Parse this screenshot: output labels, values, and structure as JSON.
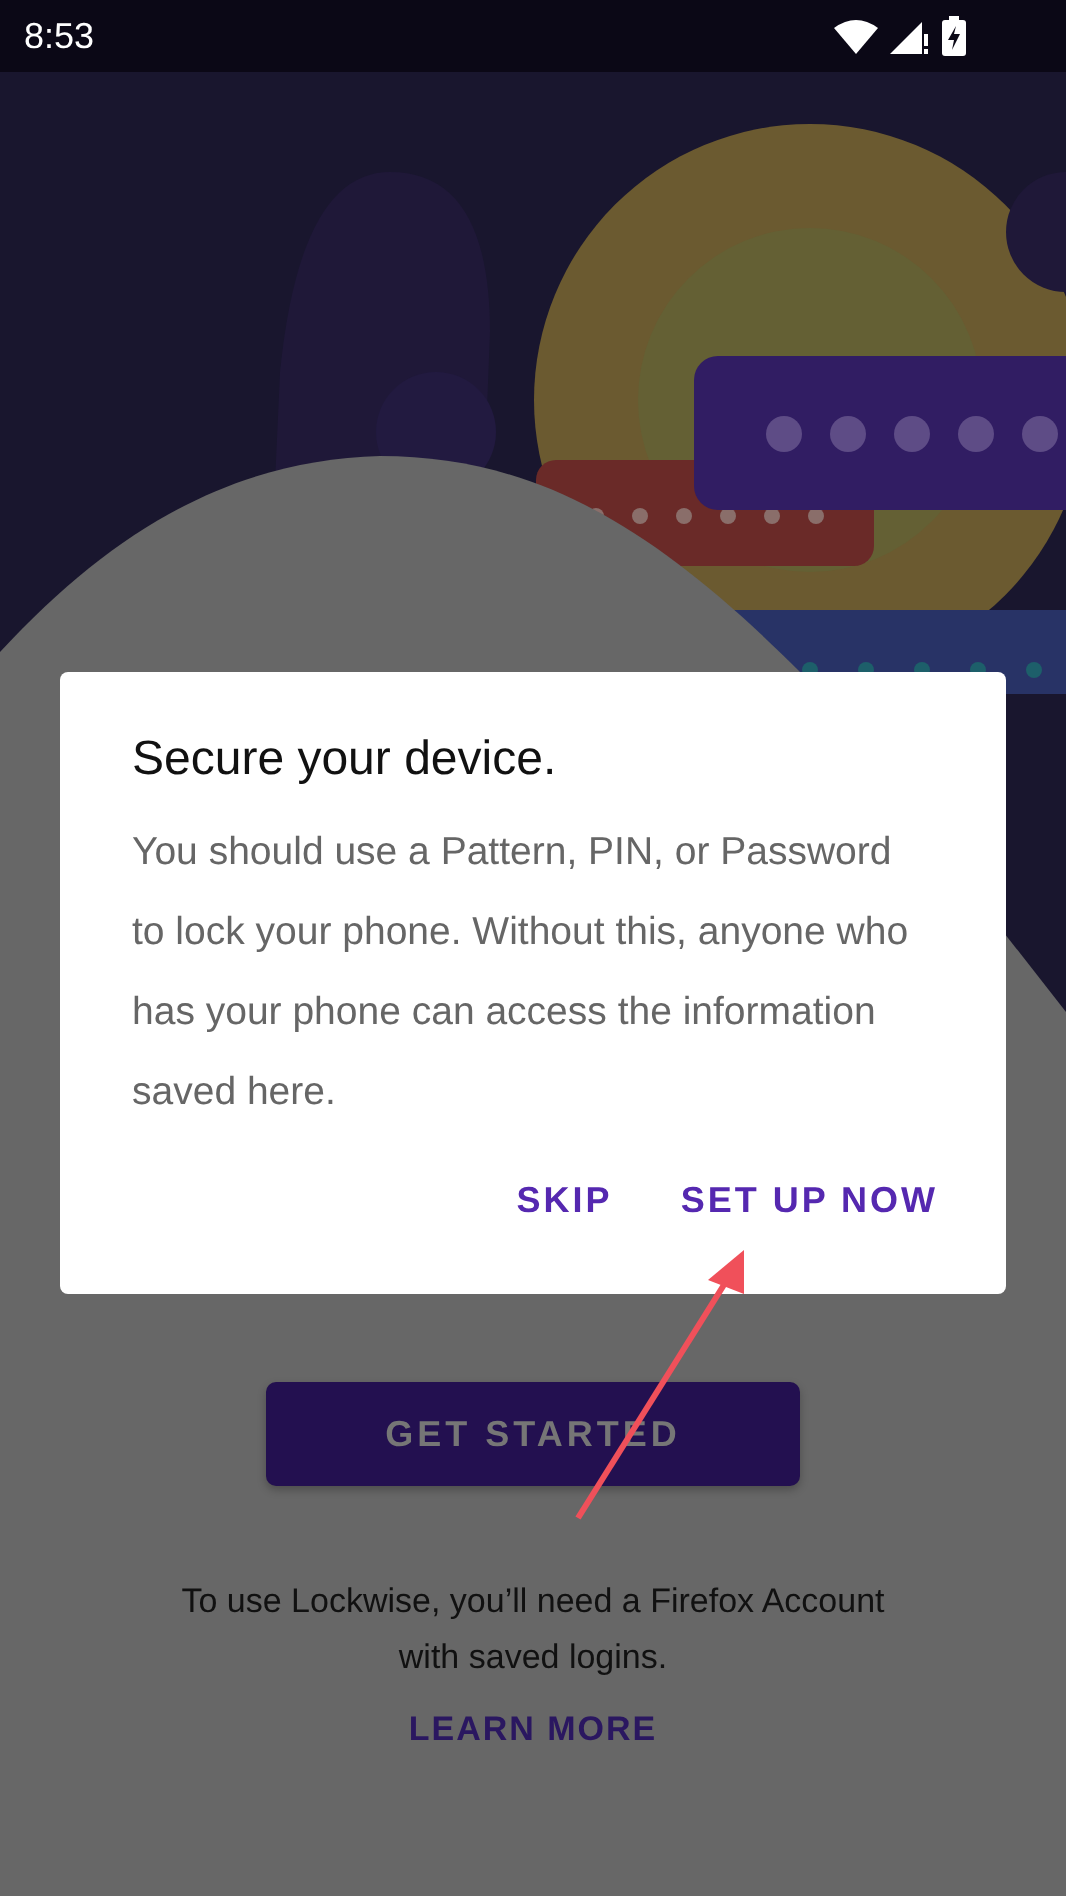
{
  "status_bar": {
    "time": "8:53"
  },
  "dialog": {
    "title": "Secure your device.",
    "message": "You should use a Pattern, PIN, or Password to lock your phone. Without this, anyone who has your phone can access the information saved here.",
    "buttons": [
      {
        "label": "SKIP"
      },
      {
        "label": "SET UP NOW"
      }
    ]
  },
  "onboarding": {
    "button": "GET STARTED",
    "message": "To use Lockwise, you’ll need a Firefox Account with saved logins.",
    "link": "LEARN MORE"
  }
}
